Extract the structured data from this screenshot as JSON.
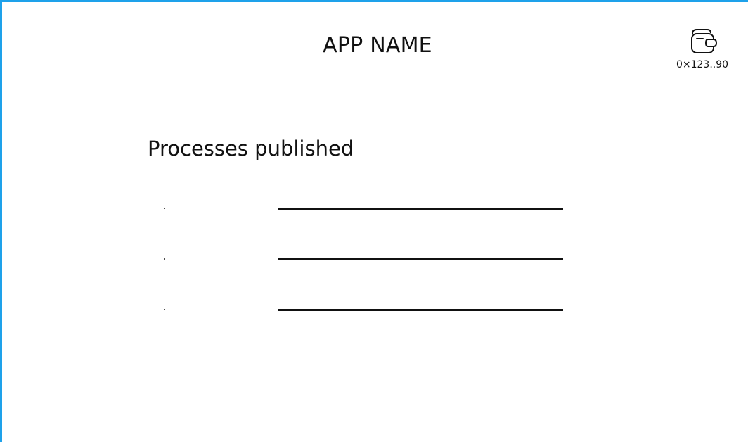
{
  "header": {
    "app_name": "APP NAME"
  },
  "wallet": {
    "icon": "wallet-icon",
    "address": "0×123..90"
  },
  "main": {
    "title": "Processes published",
    "processes": [
      {
        "name": ""
      },
      {
        "name": ""
      },
      {
        "name": ""
      }
    ]
  },
  "colors": {
    "frame_border": "#1ea1ea",
    "text": "#111111",
    "background": "#ffffff"
  }
}
